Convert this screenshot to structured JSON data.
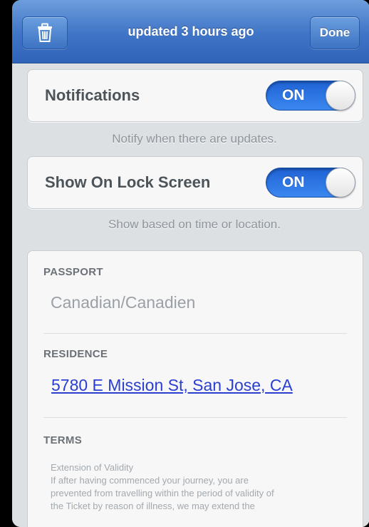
{
  "header": {
    "status": "updated 3 hours ago",
    "done_label": "Done"
  },
  "settings": {
    "notifications": {
      "label": "Notifications",
      "state": "ON",
      "note": "Notify when there are updates."
    },
    "lock_screen": {
      "label": "Show On Lock Screen",
      "state": "ON",
      "note": "Show based on time or location."
    }
  },
  "pass_fields": {
    "passport": {
      "label": "PASSPORT",
      "value": "Canadian/Canadien"
    },
    "residence": {
      "label": "RESIDENCE",
      "value": "5780 E Mission St, San Jose, CA"
    },
    "terms": {
      "label": "TERMS",
      "lines": [
        "Extension of Validity",
        "If after having commenced your journey, you are",
        "prevented from travelling within the period of validity of",
        "the Ticket by reason of illness, we may extend the"
      ]
    }
  },
  "icons": {
    "trash": "trash-icon"
  },
  "colors": {
    "bar_blue": "#3f74c6",
    "toggle_blue": "#2a6fe0",
    "link_blue": "#2a3fd0"
  }
}
